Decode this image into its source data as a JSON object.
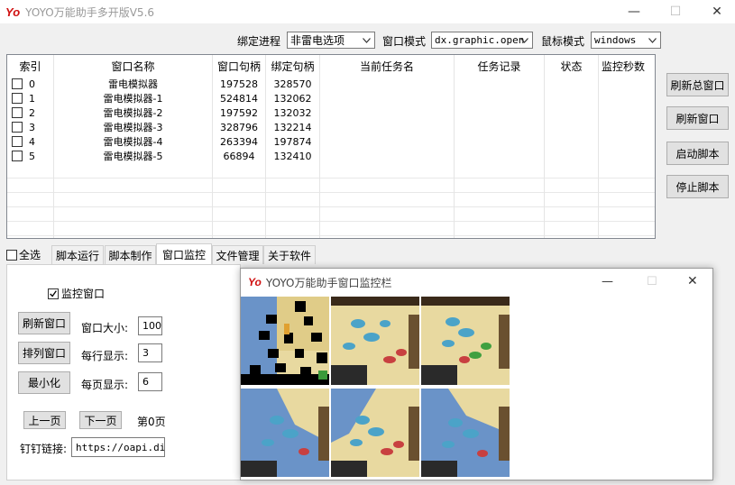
{
  "app": {
    "logo": "Yo",
    "title": "YOYO万能助手多开版V5.6",
    "minimize": "—",
    "maximize": "☐",
    "close": "✕"
  },
  "options": {
    "bind_process_label": "绑定进程",
    "bind_process_value": "非雷电选项",
    "window_mode_label": "窗口模式",
    "window_mode_value": "dx.graphic.open",
    "mouse_mode_label": "鼠标模式",
    "mouse_mode_value": "windows"
  },
  "table": {
    "columns": [
      "索引",
      "窗口名称",
      "窗口句柄",
      "绑定句柄",
      "当前任务名",
      "任务记录",
      "状态",
      "监控秒数"
    ],
    "rows": [
      {
        "index": "0",
        "name": "雷电模拟器",
        "hwnd": "197528",
        "bind": "328570"
      },
      {
        "index": "1",
        "name": "雷电模拟器-1",
        "hwnd": "524814",
        "bind": "132062"
      },
      {
        "index": "2",
        "name": "雷电模拟器-2",
        "hwnd": "197592",
        "bind": "132032"
      },
      {
        "index": "3",
        "name": "雷电模拟器-3",
        "hwnd": "328796",
        "bind": "132214"
      },
      {
        "index": "4",
        "name": "雷电模拟器-4",
        "hwnd": "263394",
        "bind": "197874"
      },
      {
        "index": "5",
        "name": "雷电模拟器-5",
        "hwnd": "66894",
        "bind": "132410"
      }
    ]
  },
  "side_buttons": {
    "refresh_main": "刷新总窗口",
    "refresh": "刷新窗口",
    "start_script": "启动脚本",
    "stop_script": "停止脚本"
  },
  "select_all": "全选",
  "tabs": [
    "脚本运行",
    "脚本制作",
    "窗口监控",
    "文件管理",
    "关于软件"
  ],
  "monitor_panel": {
    "monitor_checkbox": "监控窗口",
    "refresh_btn": "刷新窗口",
    "arrange_btn": "排列窗口",
    "minimize_btn": "最小化",
    "window_size_label": "窗口大小:",
    "window_size_value": "100",
    "per_row_label": "每行显示:",
    "per_row_value": "3",
    "per_page_label": "每页显示:",
    "per_page_value": "6",
    "prev_page": "上一页",
    "next_page": "下一页",
    "page_text": "第0页",
    "dingtalk_label": "钉钉链接:",
    "dingtalk_value": "https://oapi.ding"
  },
  "monitor_window": {
    "logo": "Yo",
    "title": "YOYO万能助手窗口监控栏",
    "minimize": "—",
    "maximize": "☐",
    "close": "✕"
  },
  "colors": {
    "logo": "#d01010",
    "sand": "#e8d9a0",
    "water": "#6a93c8"
  }
}
